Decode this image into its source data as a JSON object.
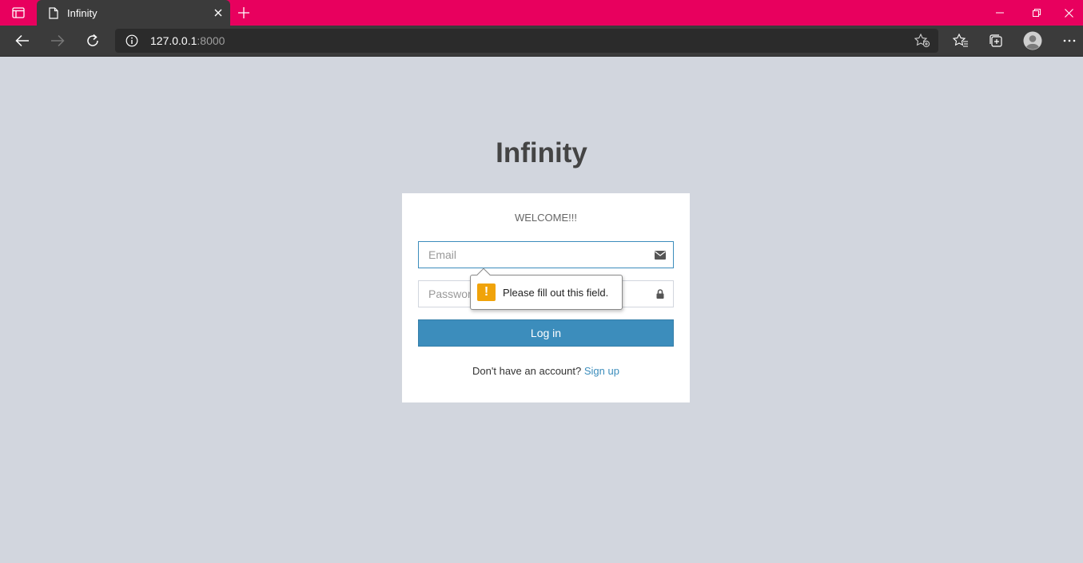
{
  "browser": {
    "tab_title": "Infinity",
    "url_host": "127.0.0.1",
    "url_port": ":8000",
    "accent_color": "#e8005e",
    "icons": [
      "tab-actions-icon",
      "page-icon",
      "close-icon",
      "plus-icon",
      "minimize-icon",
      "restore-icon",
      "back-arrow-icon",
      "forward-arrow-icon",
      "refresh-icon",
      "info-icon",
      "add-favorite-icon",
      "favorites-icon",
      "collections-icon",
      "profile-icon",
      "more-icon"
    ]
  },
  "page": {
    "logo": "Infinity",
    "background_color": "#d2d6de",
    "card": {
      "welcome": "WELCOME!!!",
      "email_placeholder": "Email",
      "password_placeholder": "Password",
      "login_label": "Log in",
      "signup_prompt": "Don't have an account?",
      "signup_link": "Sign up",
      "primary_color": "#3c8dbc"
    },
    "validation": {
      "message": "Please fill out this field."
    }
  }
}
